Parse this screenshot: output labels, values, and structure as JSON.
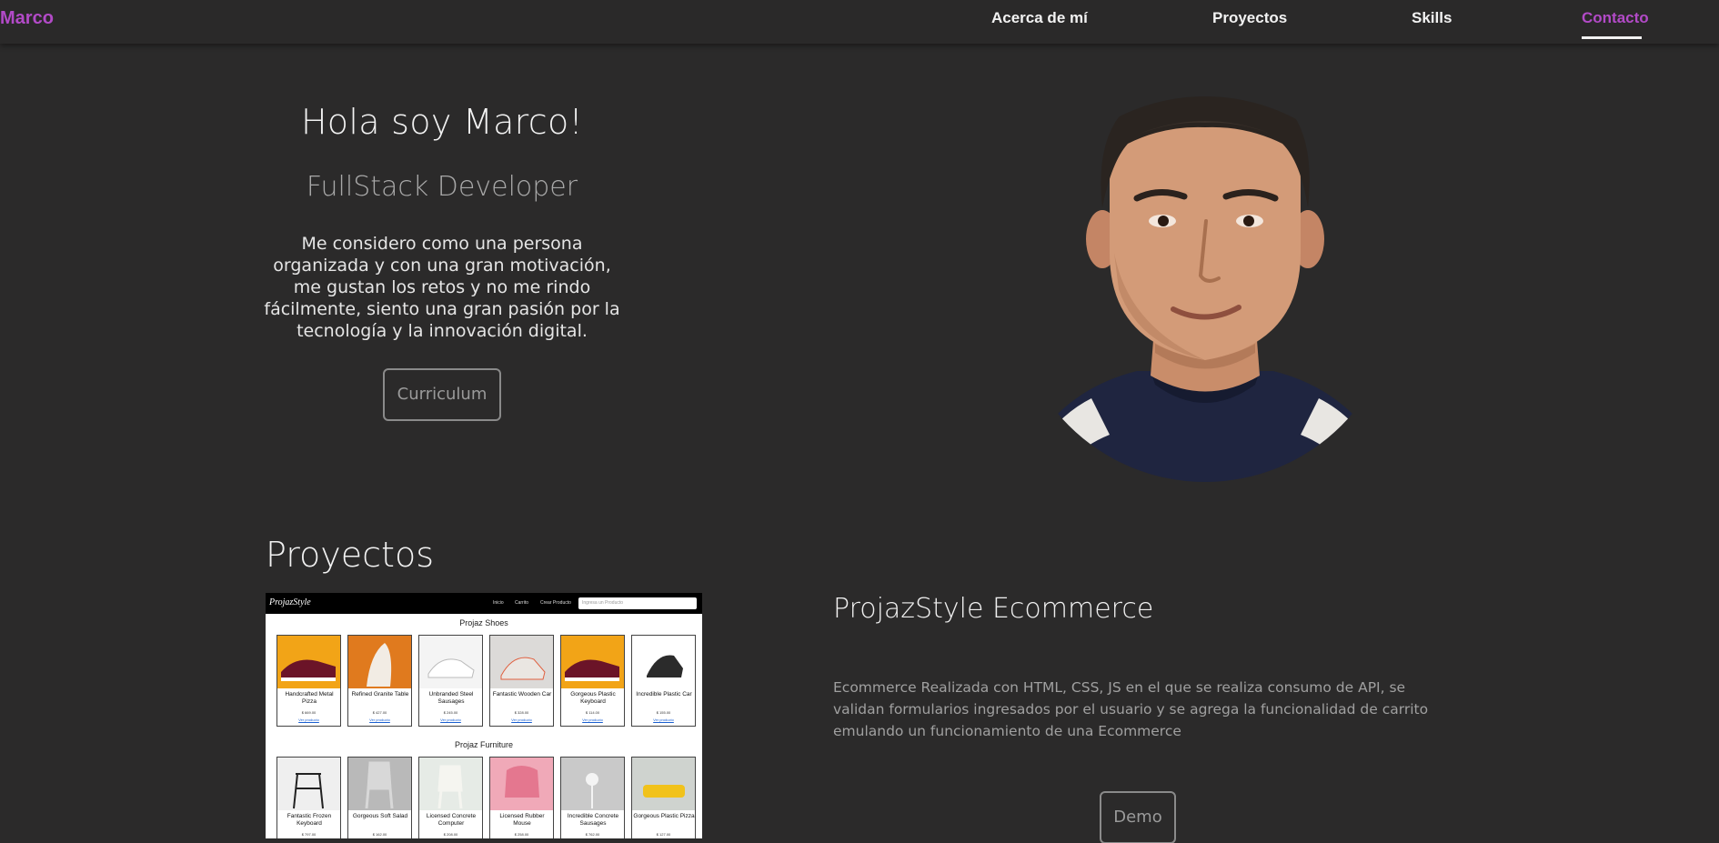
{
  "nav": {
    "brand": "Marco",
    "links": [
      "Acerca de mí",
      "Proyectos",
      "Skills",
      "Contacto"
    ],
    "active": "Contacto",
    "accent_color": "#b24ac7"
  },
  "hero": {
    "title": "Hola soy Marco!",
    "subtitle": "FullStack Developer",
    "description": "Me considero como una persona organizada y con una gran motivación, me gustan los retos y no me rindo fácilmente, siento una gran pasión por la tecnología y la innovación digital.",
    "cta": "Curriculum"
  },
  "projects": {
    "heading": "Proyectos",
    "items": [
      {
        "title": "ProjazStyle Ecommerce",
        "description": "Ecommerce Realizada con HTML, CSS, JS en el que se realiza consumo de API, se validan formularios ingresados por el usuario y se agrega la funcionalidad de carrito emulando un funcionamiento de una Ecommerce",
        "cta": "Demo",
        "screenshot": {
          "logo": "ProjazStyle",
          "menu": [
            "Inicio",
            "Carrito",
            "Crear Producto"
          ],
          "search_placeholder": "Ingresa un Producto",
          "sections": [
            {
              "title": "Projaz Shoes",
              "cards": [
                {
                  "name": "Handcrafted Metal Pizza",
                  "price": "$ 669.00",
                  "link": "Ver producto"
                },
                {
                  "name": "Refined Granite Table",
                  "price": "$ 427.00",
                  "link": "Ver producto"
                },
                {
                  "name": "Unbranded Steel Sausages",
                  "price": "$ 245.00",
                  "link": "Ver producto"
                },
                {
                  "name": "Fantastic Wooden Car",
                  "price": "$ 328.00",
                  "link": "Ver producto"
                },
                {
                  "name": "Gorgeous Plastic Keyboard",
                  "price": "$ 114.00",
                  "link": "Ver producto"
                },
                {
                  "name": "Incredible Plastic Car",
                  "price": "$ 155.00",
                  "link": "Ver producto"
                }
              ]
            },
            {
              "title": "Projaz Furniture",
              "cards": [
                {
                  "name": "Fantastic Frozen Keyboard",
                  "price": "$ 797.00",
                  "link": ""
                },
                {
                  "name": "Gorgeous Soft Salad",
                  "price": "$ 162.00",
                  "link": ""
                },
                {
                  "name": "Licensed Concrete Computer",
                  "price": "$ 208.00",
                  "link": ""
                },
                {
                  "name": "Licensed Rubber Mouse",
                  "price": "$ 258.00",
                  "link": ""
                },
                {
                  "name": "Incredible Concrete Sausages",
                  "price": "$ 762.00",
                  "link": ""
                },
                {
                  "name": "Gorgeous Plastic Pizza",
                  "price": "$ 127.00",
                  "link": ""
                }
              ]
            }
          ]
        }
      }
    ]
  }
}
